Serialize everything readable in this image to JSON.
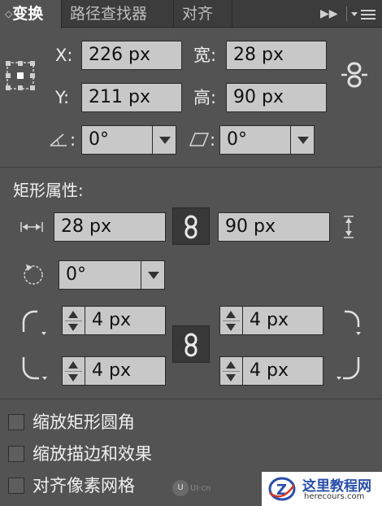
{
  "tabs": [
    {
      "label": "变换"
    },
    {
      "label": "路径查找器"
    },
    {
      "label": "对齐"
    }
  ],
  "transform": {
    "x_label": "X:",
    "x_value": "226 px",
    "y_label": "Y:",
    "y_value": "211 px",
    "w_label": "宽:",
    "w_value": "28 px",
    "h_label": "高:",
    "h_value": "90 px",
    "angle_value": "0°",
    "shear_value": "0°",
    "colon": ":"
  },
  "rect_props": {
    "title": "矩形属性:",
    "width_value": "28 px",
    "height_value": "90 px",
    "rotate_value": "0°",
    "corner_tl": "4 px",
    "corner_tr": "4 px",
    "corner_bl": "4 px",
    "corner_br": "4 px"
  },
  "options": [
    {
      "label": "缩放矩形圆角",
      "checked": false
    },
    {
      "label": "缩放描边和效果",
      "checked": false
    },
    {
      "label": "对齐像素网格",
      "checked": false
    }
  ],
  "watermark": {
    "ui_logo": "UI·cn",
    "site_name": "这里教程网",
    "site_url": "herecours.com"
  }
}
